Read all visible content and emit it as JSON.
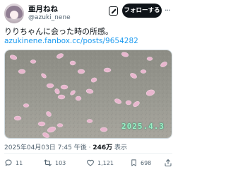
{
  "author": {
    "display_name": "亜月ねね",
    "handle": "@azuki_nene",
    "avatar_icon": "avatar"
  },
  "header": {
    "follow_label": "フォローする",
    "more_icon": "more-horizontal-icon",
    "grok_icon": "grok-icon"
  },
  "tweet": {
    "text": "りりちゃんに会った時の所感。",
    "link": "azukinene.fanbox.cc/posts/9654282"
  },
  "media": {
    "description_icon": "photo",
    "stamp": "2025.4.3"
  },
  "meta": {
    "datetime": "2025年04月03日 7:45 午後 · ",
    "views_count": "246万",
    "views_label": " 表示"
  },
  "actions": {
    "reply_count": "11",
    "retweet_count": "103",
    "like_count": "1,121",
    "bookmark_count": "698"
  },
  "colors": {
    "link": "#1d9bf0",
    "follow_bg": "#0f1419",
    "muted": "#536471"
  }
}
